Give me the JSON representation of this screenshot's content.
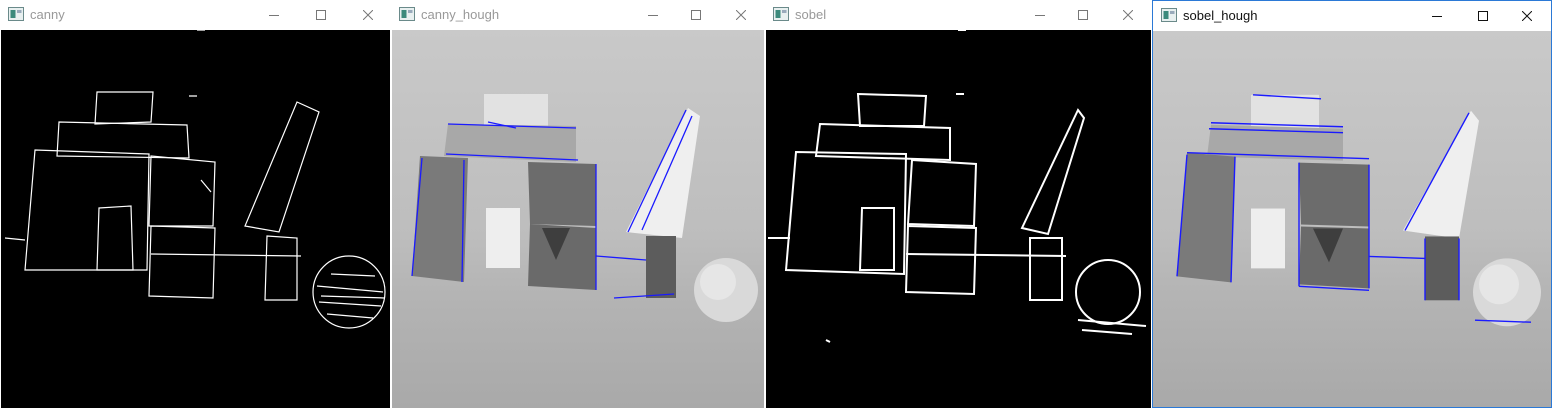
{
  "windows": [
    {
      "id": "canny",
      "title": "canny",
      "active": false,
      "view": "edges"
    },
    {
      "id": "canny_hough",
      "title": "canny_hough",
      "active": false,
      "view": "photo"
    },
    {
      "id": "sobel",
      "title": "sobel",
      "active": false,
      "view": "edges"
    },
    {
      "id": "sobel_hough",
      "title": "sobel_hough",
      "active": true,
      "view": "photo"
    }
  ],
  "colors": {
    "edge_line": "#ffffff",
    "hough_line": "#1a1aff",
    "titlebar_inactive_text": "#999999",
    "titlebar_active_text": "#111111",
    "active_border": "#2b79d6"
  },
  "icons": {
    "app": "opencv-window-icon",
    "minimize": "minimize-icon",
    "maximize": "maximize-icon",
    "close": "close-icon"
  }
}
